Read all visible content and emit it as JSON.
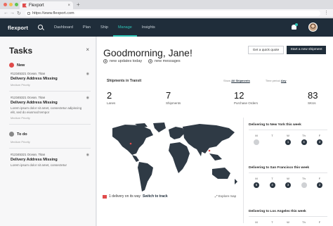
{
  "browser": {
    "tab_title": "Flexport",
    "tab_close": "×",
    "new_tab": "+",
    "url": "https://www.flexport.com",
    "nav_back": "←",
    "nav_forward": "→",
    "nav_reload": "↻",
    "menu": "⋮",
    "dot_colors": [
      "#ec6a5e",
      "#f4bf4f",
      "#61c554"
    ]
  },
  "app_nav": {
    "logo": "flexport",
    "links": [
      "Dashboard",
      "Plan",
      "Ship",
      "Manage",
      "Insights"
    ],
    "active_link": "Manage",
    "accent": "#2ec4b6"
  },
  "tasks": {
    "title": "Tasks",
    "close": "×",
    "sections": [
      {
        "label": "New",
        "items": [
          {
            "id": "#12345321 Ocean. Titan",
            "title": "Delivery Address Missing",
            "body": "",
            "priority": "Medium Priority"
          },
          {
            "id": "#12345321 Ocean. Titan",
            "title": "Delivery Address Missing",
            "body": "Lorem ipsum dolor sit amet, consectetur adipiscing elit, sed do eiusmod tempor",
            "priority": "Medium Priority"
          }
        ]
      },
      {
        "label": "To do",
        "items": [
          {
            "id": "",
            "title": "",
            "body": "",
            "priority": "Medium Priority"
          },
          {
            "id": "#12345321 Ocean. Titan",
            "title": "Delivery Address Missing",
            "body": "Lorem ipsum dolor sit amet, consectetur",
            "priority": ""
          }
        ]
      }
    ]
  },
  "main": {
    "greeting": "Goodmorning, Jane!",
    "quote_button": "Get a quick quote",
    "ship_button": "Start a new shipment",
    "updates": [
      {
        "count": "4",
        "label": "new updates today"
      },
      {
        "count": "4",
        "label": "new messages"
      }
    ],
    "shipments_heading": "Shipments in Transit",
    "filter_show_label": "Show",
    "filter_show_value": "All Shipments",
    "filter_time_label": "Time period",
    "filter_time_value": "Any",
    "stats": [
      {
        "value": "2",
        "label": "Lanes"
      },
      {
        "value": "7",
        "label": "Shipments"
      },
      {
        "value": "12",
        "label": "Purchase Orders"
      },
      {
        "value": "83",
        "label": "SKUs"
      }
    ],
    "map_notice_count": "1 delivery on its way",
    "map_notice_link": "Switch to track",
    "explore_label": "Explore map",
    "deliveries": [
      {
        "title": "Delivering to New York this week",
        "days": [
          {
            "label": "M",
            "state": "light",
            "count": ""
          },
          {
            "label": "T",
            "state": "empty",
            "count": ""
          },
          {
            "label": "W",
            "state": "dark",
            "count": "1"
          },
          {
            "label": "Th",
            "state": "dark",
            "count": "4"
          },
          {
            "label": "F",
            "state": "dark",
            "count": "3"
          }
        ]
      },
      {
        "title": "Delivering to San Francisco this week",
        "days": [
          {
            "label": "M",
            "state": "dark",
            "count": "6"
          },
          {
            "label": "T",
            "state": "dark",
            "count": "4"
          },
          {
            "label": "W",
            "state": "dark",
            "count": "3"
          },
          {
            "label": "Th",
            "state": "light",
            "count": ""
          },
          {
            "label": "F",
            "state": "dark",
            "count": "2"
          }
        ]
      },
      {
        "title": "Delivering to Los Angeles this week",
        "days": [
          {
            "label": "M",
            "state": "dark",
            "count": ""
          },
          {
            "label": "T",
            "state": "dark",
            "count": ""
          },
          {
            "label": "W",
            "state": "dark",
            "count": ""
          },
          {
            "label": "Th",
            "state": "dark",
            "count": ""
          },
          {
            "label": "F",
            "state": "dark",
            "count": ""
          }
        ]
      }
    ]
  },
  "colors": {
    "nav_bg": "#1f2d3a",
    "alert_red": "#e04b4b",
    "dark_dot": "#2a3540"
  }
}
